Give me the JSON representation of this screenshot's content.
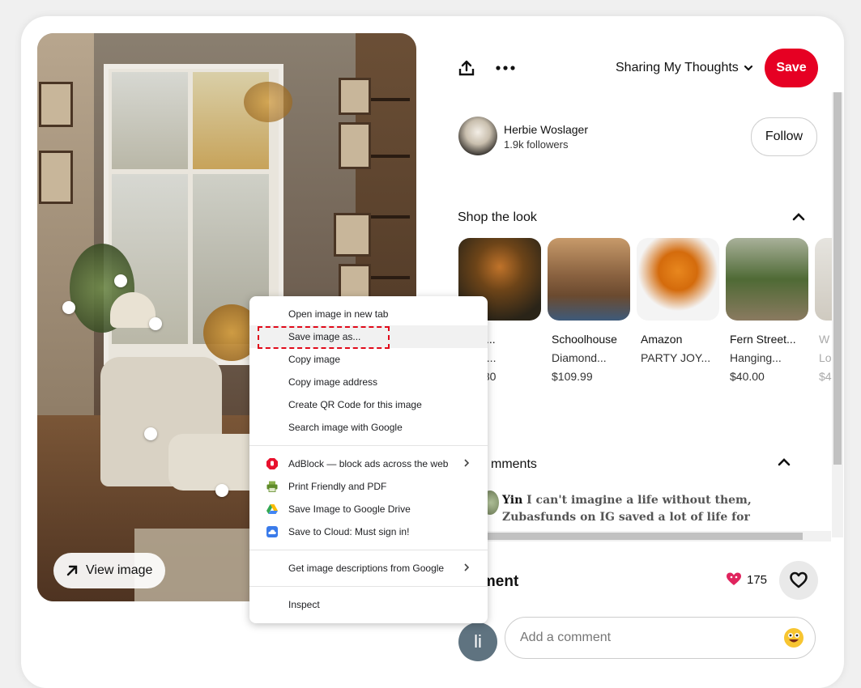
{
  "image_panel": {
    "view_image_label": "View image"
  },
  "header": {
    "board_name": "Sharing My Thoughts",
    "save_label": "Save"
  },
  "author": {
    "name": "Herbie Woslager",
    "followers": "1.9k followers",
    "follow_label": "Follow"
  },
  "shop": {
    "title": "Shop the look",
    "products": [
      {
        "name": "chalo -...",
        "sub": "b...",
        "price": ".80",
        "colors": [
          "#2a2418",
          "#c0732a"
        ]
      },
      {
        "name": "Schoolhouse",
        "sub": "Diamond...",
        "price": "$109.99",
        "colors": [
          "#6b4a2f",
          "#c79a6a"
        ]
      },
      {
        "name": "Amazon",
        "sub": "PARTY JOY...",
        "price": "",
        "colors": [
          "#f4f4f4",
          "#e8871e"
        ]
      },
      {
        "name": "Fern Street...",
        "sub": "Hanging...",
        "price": "$40.00",
        "colors": [
          "#a9b19a",
          "#4f6a35"
        ]
      },
      {
        "name": "W",
        "sub": "Lo",
        "price": "$4",
        "colors": [
          "#e6e4df",
          "#cfcac0"
        ]
      }
    ]
  },
  "comments": {
    "title": "mments",
    "first_comment_author": "Yin",
    "first_comment_text": "I can't imagine a life without them, Zubasfunds on IG saved a lot of life for",
    "heading": "mment",
    "reaction_count": "175",
    "user_initial": "li",
    "input_placeholder": "Add a comment"
  },
  "context_menu": {
    "items": [
      {
        "label": "Open image in new tab"
      },
      {
        "label": "Save image as..."
      },
      {
        "label": "Copy image"
      },
      {
        "label": "Copy image address"
      },
      {
        "label": "Create QR Code for this image"
      },
      {
        "label": "Search image with Google"
      },
      {
        "label": "AdBlock — block ads across the web"
      },
      {
        "label": "Print Friendly and PDF"
      },
      {
        "label": "Save Image to Google Drive"
      },
      {
        "label": "Save to Cloud: Must sign in!"
      },
      {
        "label": "Get image descriptions from Google"
      },
      {
        "label": "Inspect"
      }
    ],
    "icons": [
      "adblock-icon",
      "print-friendly-icon",
      "google-drive-icon",
      "save-to-cloud-icon"
    ]
  },
  "colors": {
    "save_red": "#e60023",
    "highlight_dash": "#e10a1a",
    "menu_highlight": "#f1f1f1"
  }
}
